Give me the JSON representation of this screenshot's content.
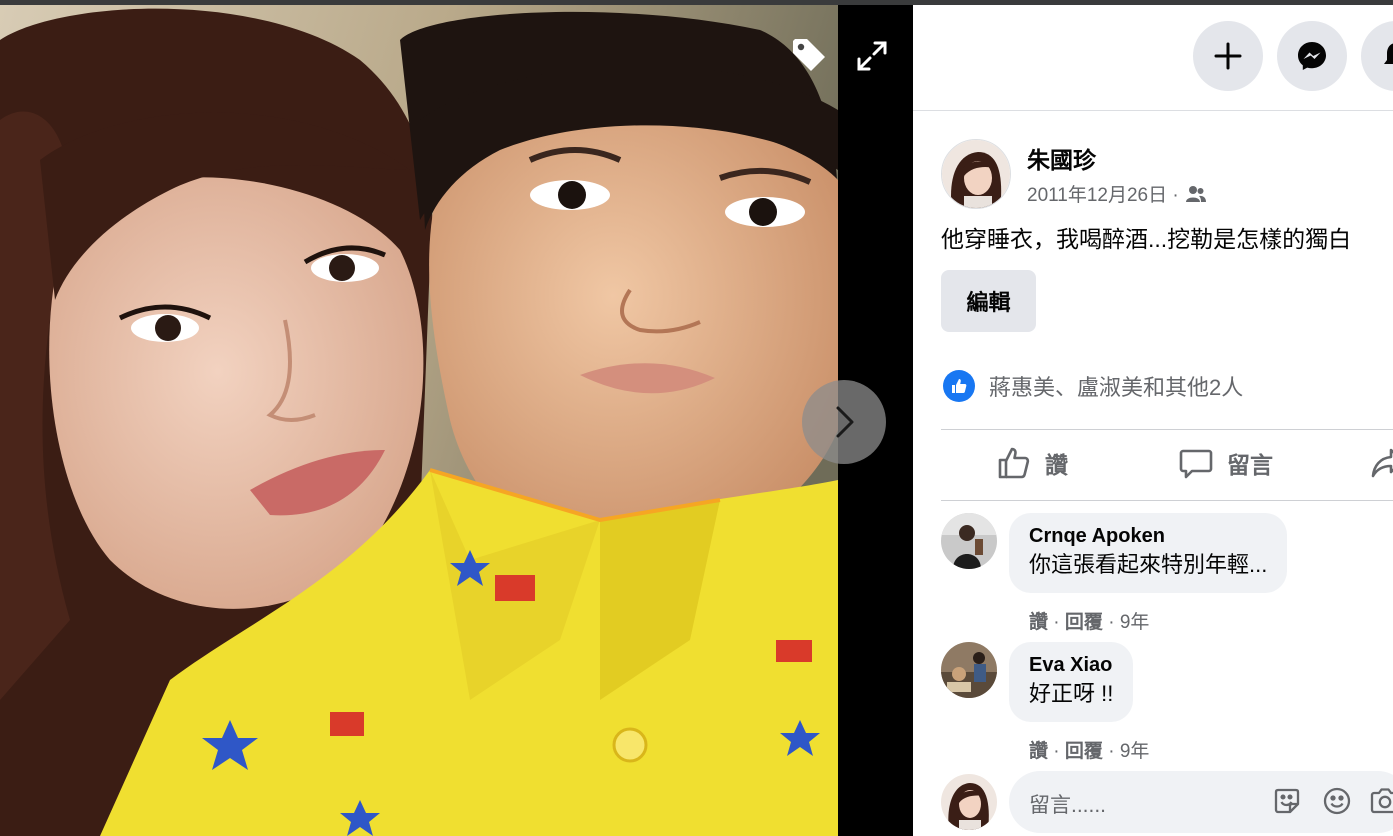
{
  "viewer": {
    "photo_alt": "",
    "tag_icon": "tag-icon",
    "expand_icon": "expand-icon",
    "next_icon": "chevron-right-icon"
  },
  "header": {
    "buttons": [
      {
        "icon": "plus-icon"
      },
      {
        "icon": "messenger-icon"
      },
      {
        "icon": "bell-icon"
      }
    ]
  },
  "post": {
    "author": "朱國珍",
    "date": "2011年12月26日 ·",
    "audience_icon": "friends-icon",
    "caption": "他穿睡衣，我喝醉酒...挖勒是怎樣的獨白",
    "edit_label": "編輯",
    "reactions_text": "蔣惠美、盧淑美和其他2人"
  },
  "actions": {
    "like": "讚",
    "comment": "留言",
    "share": ""
  },
  "comments": [
    {
      "name": "Crnqe Apoken",
      "text": "你這張看起來特別年輕...",
      "like": "讚",
      "reply": "回覆",
      "sep": "·",
      "time": "9年"
    },
    {
      "name": "Eva Xiao",
      "text": "好正呀 !!",
      "like": "讚",
      "reply": "回覆",
      "sep": "·",
      "time": "9年"
    }
  ],
  "composer": {
    "placeholder": "留言......",
    "icons": [
      "sticker-icon",
      "emoji-icon",
      "camera-icon"
    ]
  },
  "colors": {
    "accent": "#1877f2",
    "button_bg": "#e4e6eb",
    "bubble_bg": "#f0f2f5",
    "secondary_text": "#65676b"
  }
}
